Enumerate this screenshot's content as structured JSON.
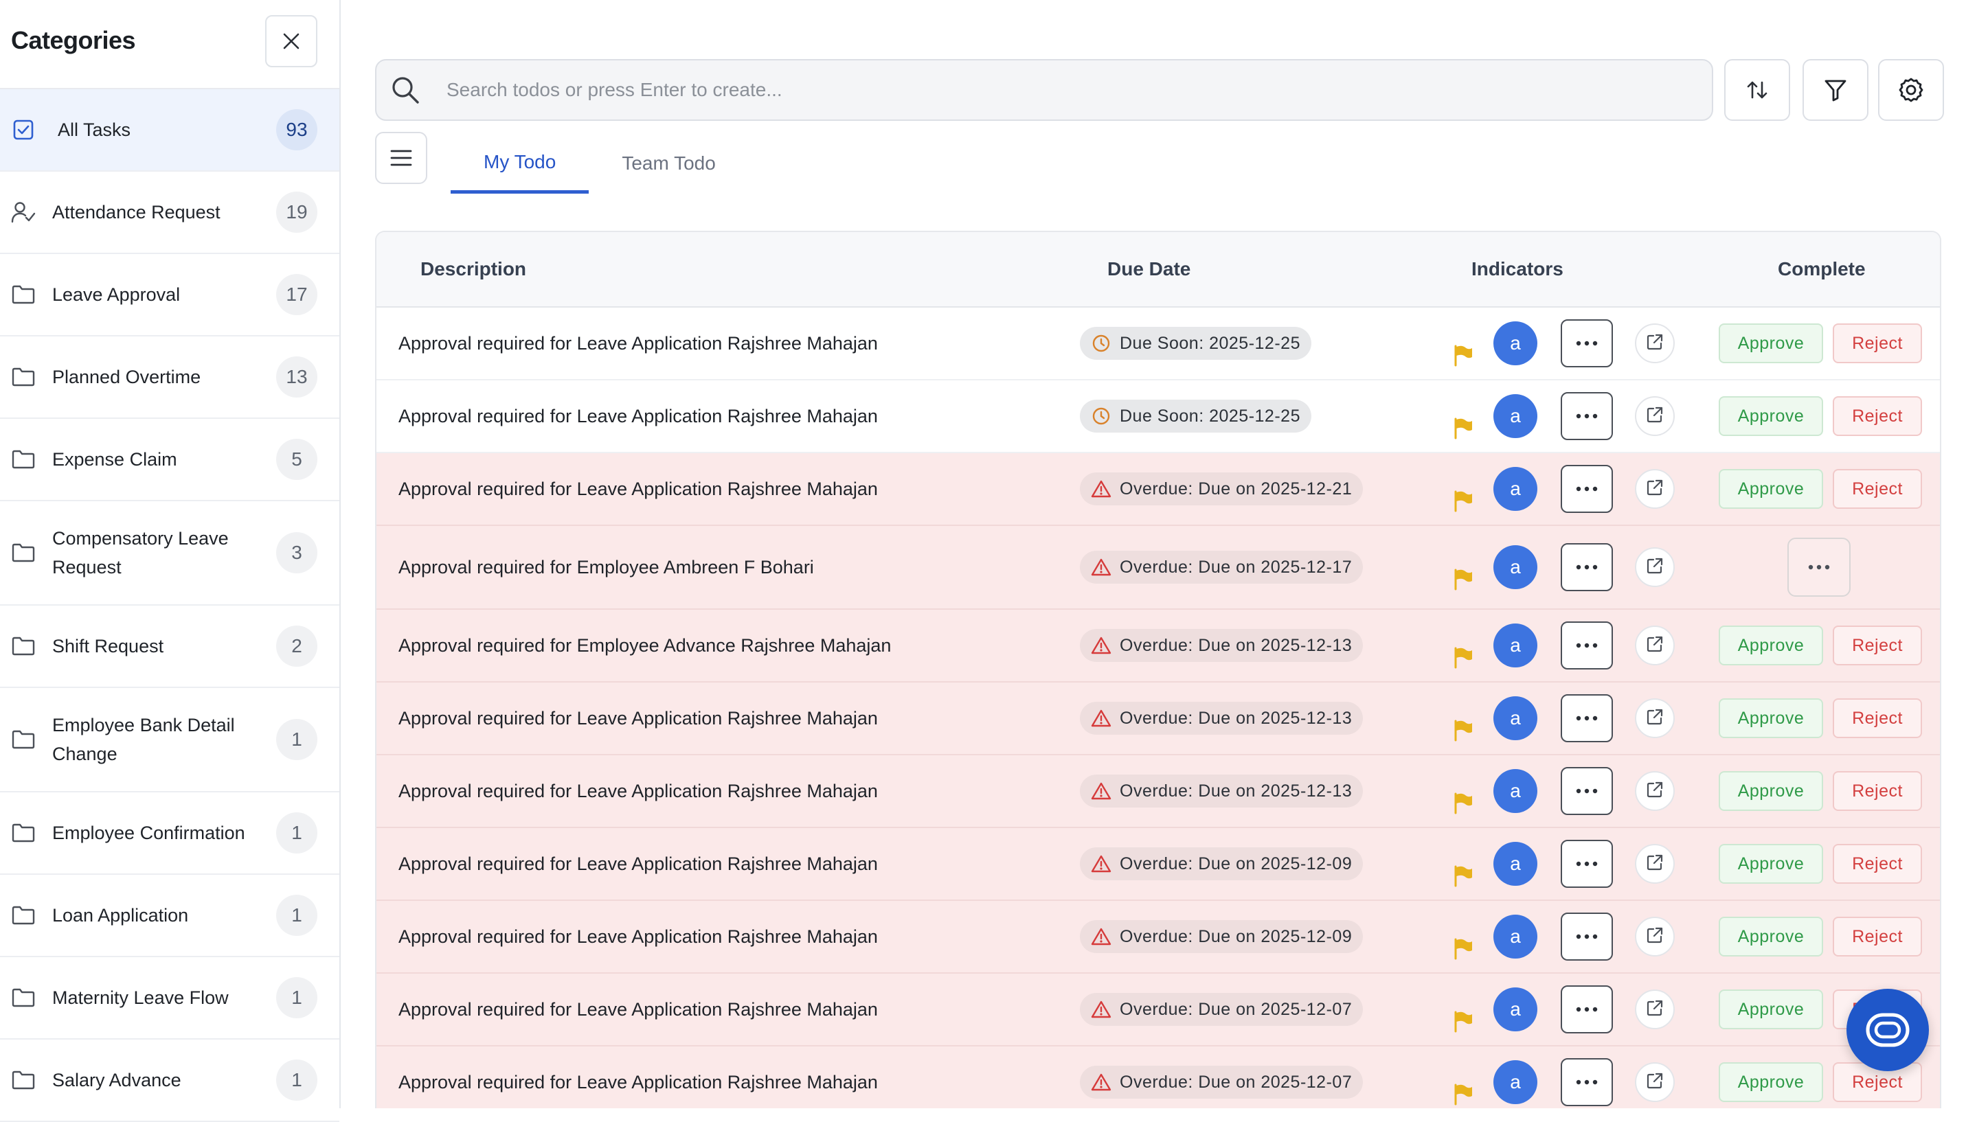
{
  "sidebar": {
    "title": "Categories",
    "items": [
      {
        "label": "All Tasks",
        "count": "93",
        "icon": "checkbox-icon"
      },
      {
        "label": "Attendance Request",
        "count": "19",
        "icon": "user-check-icon"
      },
      {
        "label": "Leave Approval",
        "count": "17",
        "icon": "folder-icon"
      },
      {
        "label": "Planned Overtime",
        "count": "13",
        "icon": "folder-icon"
      },
      {
        "label": "Expense Claim",
        "count": "5",
        "icon": "folder-icon"
      },
      {
        "label": "Compensatory Leave Request",
        "count": "3",
        "icon": "folder-icon"
      },
      {
        "label": "Shift Request",
        "count": "2",
        "icon": "folder-icon"
      },
      {
        "label": "Employee Bank Detail Change",
        "count": "1",
        "icon": "folder-icon"
      },
      {
        "label": "Employee Confirmation",
        "count": "1",
        "icon": "folder-icon"
      },
      {
        "label": "Loan Application",
        "count": "1",
        "icon": "folder-icon"
      },
      {
        "label": "Maternity Leave Flow",
        "count": "1",
        "icon": "folder-icon"
      },
      {
        "label": "Salary Advance",
        "count": "1",
        "icon": "folder-icon"
      }
    ]
  },
  "search": {
    "placeholder": "Search todos or press Enter to create..."
  },
  "tabs": [
    {
      "label": "My Todo"
    },
    {
      "label": "Team Todo"
    }
  ],
  "table": {
    "headers": {
      "description": "Description",
      "due_date": "Due Date",
      "indicators": "Indicators",
      "complete": "Complete"
    },
    "rows": [
      {
        "description": "Approval required for Leave Application Rajshree Mahajan",
        "due": "Due Soon: 2025-12-25",
        "status": "soon",
        "avatar": "a",
        "approve": "Approve",
        "reject": "Reject"
      },
      {
        "description": "Approval required for Leave Application Rajshree Mahajan",
        "due": "Due Soon: 2025-12-25",
        "status": "soon",
        "avatar": "a",
        "approve": "Approve",
        "reject": "Reject"
      },
      {
        "description": "Approval required for Leave Application Rajshree Mahajan",
        "due": "Overdue: Due on 2025-12-21",
        "status": "overdue",
        "avatar": "a",
        "approve": "Approve",
        "reject": "Reject"
      },
      {
        "description": "Approval required for Employee Ambreen F Bohari",
        "due": "Overdue: Due on 2025-12-17",
        "status": "overdue",
        "avatar": "a",
        "approve": "",
        "reject": ""
      },
      {
        "description": "Approval required for Employee Advance Rajshree Mahajan",
        "due": "Overdue: Due on 2025-12-13",
        "status": "overdue",
        "avatar": "a",
        "approve": "Approve",
        "reject": "Reject"
      },
      {
        "description": "Approval required for Leave Application Rajshree Mahajan",
        "due": "Overdue: Due on 2025-12-13",
        "status": "overdue",
        "avatar": "a",
        "approve": "Approve",
        "reject": "Reject"
      },
      {
        "description": "Approval required for Leave Application Rajshree Mahajan",
        "due": "Overdue: Due on 2025-12-13",
        "status": "overdue",
        "avatar": "a",
        "approve": "Approve",
        "reject": "Reject"
      },
      {
        "description": "Approval required for Leave Application Rajshree Mahajan",
        "due": "Overdue: Due on 2025-12-09",
        "status": "overdue",
        "avatar": "a",
        "approve": "Approve",
        "reject": "Reject"
      },
      {
        "description": "Approval required for Leave Application Rajshree Mahajan",
        "due": "Overdue: Due on 2025-12-09",
        "status": "overdue",
        "avatar": "a",
        "approve": "Approve",
        "reject": "Reject"
      },
      {
        "description": "Approval required for Leave Application Rajshree Mahajan",
        "due": "Overdue: Due on 2025-12-07",
        "status": "overdue",
        "avatar": "a",
        "approve": "Approve",
        "reject": "Reject"
      },
      {
        "description": "Approval required for Leave Application Rajshree Mahajan",
        "due": "Overdue: Due on 2025-12-07",
        "status": "overdue",
        "avatar": "a",
        "approve": "Approve",
        "reject": "Reject"
      }
    ]
  },
  "colors": {
    "accent": "#2f5fd0",
    "overdue_row": "#fbe9e9",
    "approve": "#2f9a48",
    "reject": "#d33f3f",
    "flag": "#e8b21c",
    "avatar": "#3d74e0"
  }
}
